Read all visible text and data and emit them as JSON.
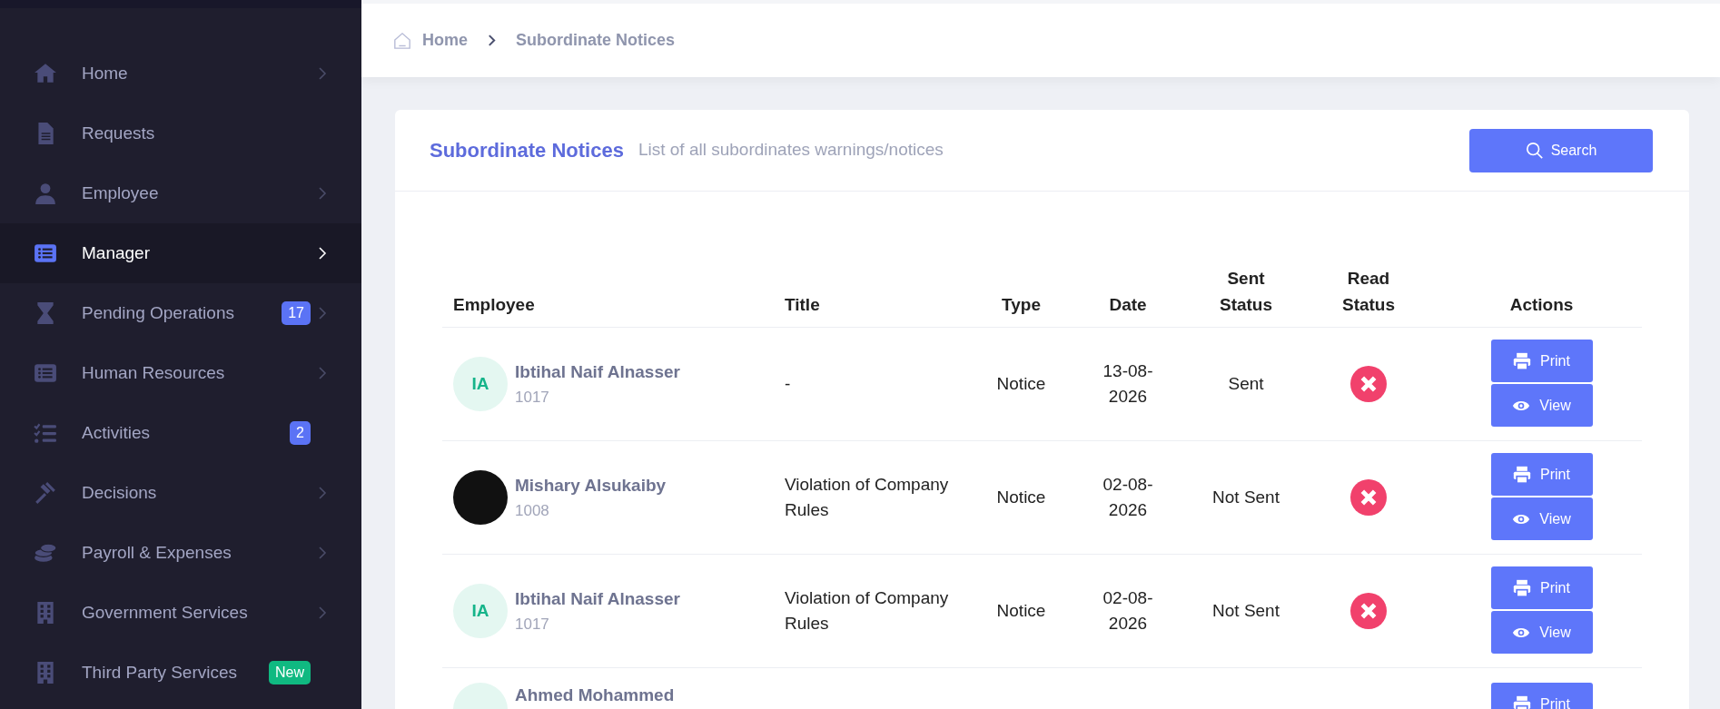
{
  "sidebar": {
    "items": [
      {
        "label": "Home",
        "selected": false,
        "has_submenu": true
      },
      {
        "label": "Requests",
        "selected": false,
        "has_submenu": false
      },
      {
        "label": "Employee",
        "selected": false,
        "has_submenu": true
      },
      {
        "label": "Manager",
        "selected": true,
        "has_submenu": true
      },
      {
        "label": "Pending Operations",
        "selected": false,
        "has_submenu": true,
        "badge": {
          "text": "17",
          "color": "#5b73f5"
        }
      },
      {
        "label": "Human Resources",
        "selected": false,
        "has_submenu": true
      },
      {
        "label": "Activities",
        "selected": false,
        "has_submenu": false,
        "badge": {
          "text": "2",
          "color": "#5b73f5"
        }
      },
      {
        "label": "Decisions",
        "selected": false,
        "has_submenu": true
      },
      {
        "label": "Payroll & Expenses",
        "selected": false,
        "has_submenu": true
      },
      {
        "label": "Government Services",
        "selected": false,
        "has_submenu": true
      },
      {
        "label": "Third Party Services",
        "selected": false,
        "has_submenu": false,
        "badge": {
          "text": "New",
          "color": "#10b981"
        }
      }
    ]
  },
  "breadcrumb": [
    {
      "label": "Home"
    },
    {
      "label": "Subordinate Notices"
    }
  ],
  "card": {
    "title": "Subordinate Notices",
    "subtitle": "List of all subordinates warnings/notices",
    "search_button": "Search"
  },
  "table": {
    "columns": [
      "Employee",
      "Title",
      "Type",
      "Date",
      "Sent Status",
      "Read Status",
      "Actions"
    ],
    "rows": [
      {
        "employee": {
          "name": "Ibtihal Naif Alnasser",
          "id": "1017",
          "avatar": {
            "kind": "initials",
            "text": "IA"
          }
        },
        "title": "-",
        "type": "Notice",
        "date": "13-08-2026",
        "sent_status": "Sent",
        "read": false,
        "actions": [
          "Print",
          "View"
        ]
      },
      {
        "employee": {
          "name": "Mishary Alsukaiby",
          "id": "1008",
          "avatar": {
            "kind": "photo"
          }
        },
        "title": "Violation of Company Rules",
        "type": "Notice",
        "date": "02-08-2026",
        "sent_status": "Not Sent",
        "read": false,
        "actions": [
          "Print",
          "View"
        ]
      },
      {
        "employee": {
          "name": "Ibtihal Naif Alnasser",
          "id": "1017",
          "avatar": {
            "kind": "initials",
            "text": "IA"
          }
        },
        "title": "Violation of Company Rules",
        "type": "Notice",
        "date": "02-08-2026",
        "sent_status": "Not Sent",
        "read": false,
        "actions": [
          "Print",
          "View"
        ]
      },
      {
        "employee": {
          "name": "Ahmed Mohammed"
        },
        "actions": [
          "Print"
        ]
      }
    ]
  }
}
